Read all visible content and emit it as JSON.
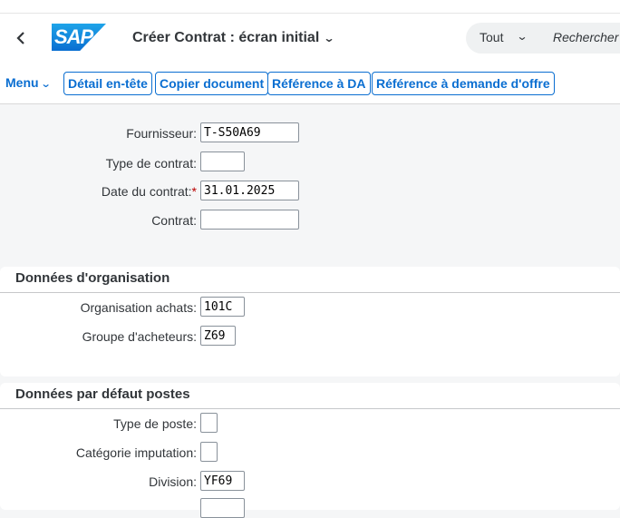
{
  "shell": {
    "title": "Créer Contrat : écran initial",
    "logo_text": "SAP",
    "search_scope": "Tout",
    "search_placeholder": "Rechercher"
  },
  "toolbar": {
    "menu_label": "Menu",
    "buttons": [
      "Détail en-tête",
      "Copier document",
      "Référence à DA",
      "Référence à demande d'offre"
    ]
  },
  "header_fields": [
    {
      "label": "Fournisseur:",
      "value": "T-S50A69",
      "required": false
    },
    {
      "label": "Type de contrat:",
      "value": "",
      "required": false
    },
    {
      "label": "Date du contrat:",
      "value": "31.01.2025",
      "required": true
    },
    {
      "label": "Contrat:",
      "value": "",
      "required": false
    }
  ],
  "org_section": {
    "title": "Données d'organisation",
    "fields": [
      {
        "label": "Organisation achats:",
        "value": "101C"
      },
      {
        "label": "Groupe d'acheteurs:",
        "value": "Z69"
      }
    ]
  },
  "defaults_section": {
    "title": "Données par défaut postes",
    "fields": [
      {
        "label": "Type de poste:",
        "value": ""
      },
      {
        "label": "Catégorie imputation:",
        "value": ""
      },
      {
        "label": "Division:",
        "value": "YF69"
      }
    ]
  },
  "colors": {
    "accent": "#0a6ed1",
    "required": "#bb0000",
    "background": "#f5f6f7"
  }
}
